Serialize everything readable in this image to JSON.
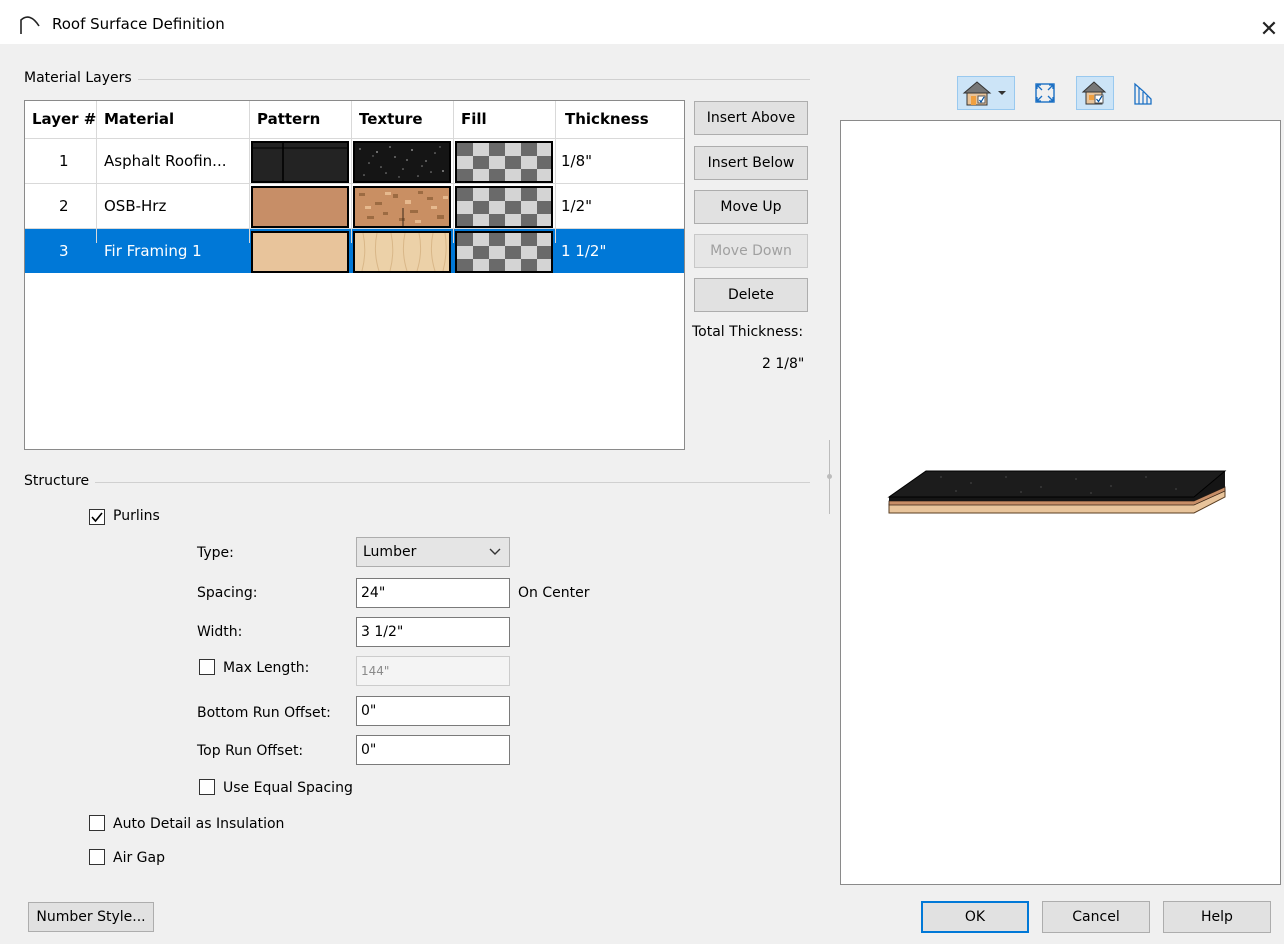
{
  "window": {
    "title": "Roof Surface Definition",
    "close_glyph": "✕"
  },
  "material_layers": {
    "group_label": "Material Layers",
    "columns": [
      "Layer #",
      "Material",
      "Pattern",
      "Texture",
      "Fill",
      "Thickness"
    ],
    "rows": [
      {
        "layer": "1",
        "material": "Asphalt Roofin...",
        "pattern": "dark-shingle",
        "texture": "black-speckle",
        "fill": "checker",
        "thickness": "1/8\"",
        "selected": false
      },
      {
        "layer": "2",
        "material": "OSB-Hrz",
        "pattern": "tan-solid",
        "texture": "osb-speckle",
        "fill": "checker",
        "thickness": "1/2\"",
        "selected": false
      },
      {
        "layer": "3",
        "material": "Fir Framing 1",
        "pattern": "light-wood",
        "texture": "fir-grain",
        "fill": "checker",
        "thickness": "1 1/2\"",
        "selected": true
      }
    ],
    "colors": {
      "selection": "#0078d7",
      "shingle": "#222222",
      "osb": "#c78e67",
      "fir": "#e8c49b"
    }
  },
  "buttons": {
    "insert_above": "Insert Above",
    "insert_below": "Insert Below",
    "move_up": "Move Up",
    "move_down": "Move Down",
    "delete": "Delete",
    "number_style": "Number Style...",
    "ok": "OK",
    "cancel": "Cancel",
    "help": "Help"
  },
  "total_thickness": {
    "label": "Total Thickness:",
    "value": "2 1/8\""
  },
  "structure": {
    "group_label": "Structure",
    "purlins": {
      "label": "Purlins",
      "checked": true
    },
    "type": {
      "label": "Type:",
      "value": "Lumber"
    },
    "spacing": {
      "label": "Spacing:",
      "value": "24\"",
      "suffix": "On Center"
    },
    "width": {
      "label": "Width:",
      "value": "3 1/2\""
    },
    "max_length": {
      "label": "Max Length:",
      "value": "144\"",
      "checked": false
    },
    "bottom_run_offset": {
      "label": "Bottom Run Offset:",
      "value": "0\""
    },
    "top_run_offset": {
      "label": "Top Run Offset:",
      "value": "0\""
    },
    "use_equal_spacing": {
      "label": "Use Equal Spacing",
      "checked": false
    },
    "auto_detail": {
      "label": "Auto Detail as Insulation",
      "checked": false
    },
    "air_gap": {
      "label": "Air Gap",
      "checked": false
    }
  },
  "preview_toolbar": {
    "icons": [
      "house-view-dropdown-icon",
      "fill-window-icon",
      "toggle-color-icon",
      "layers-icon"
    ]
  }
}
